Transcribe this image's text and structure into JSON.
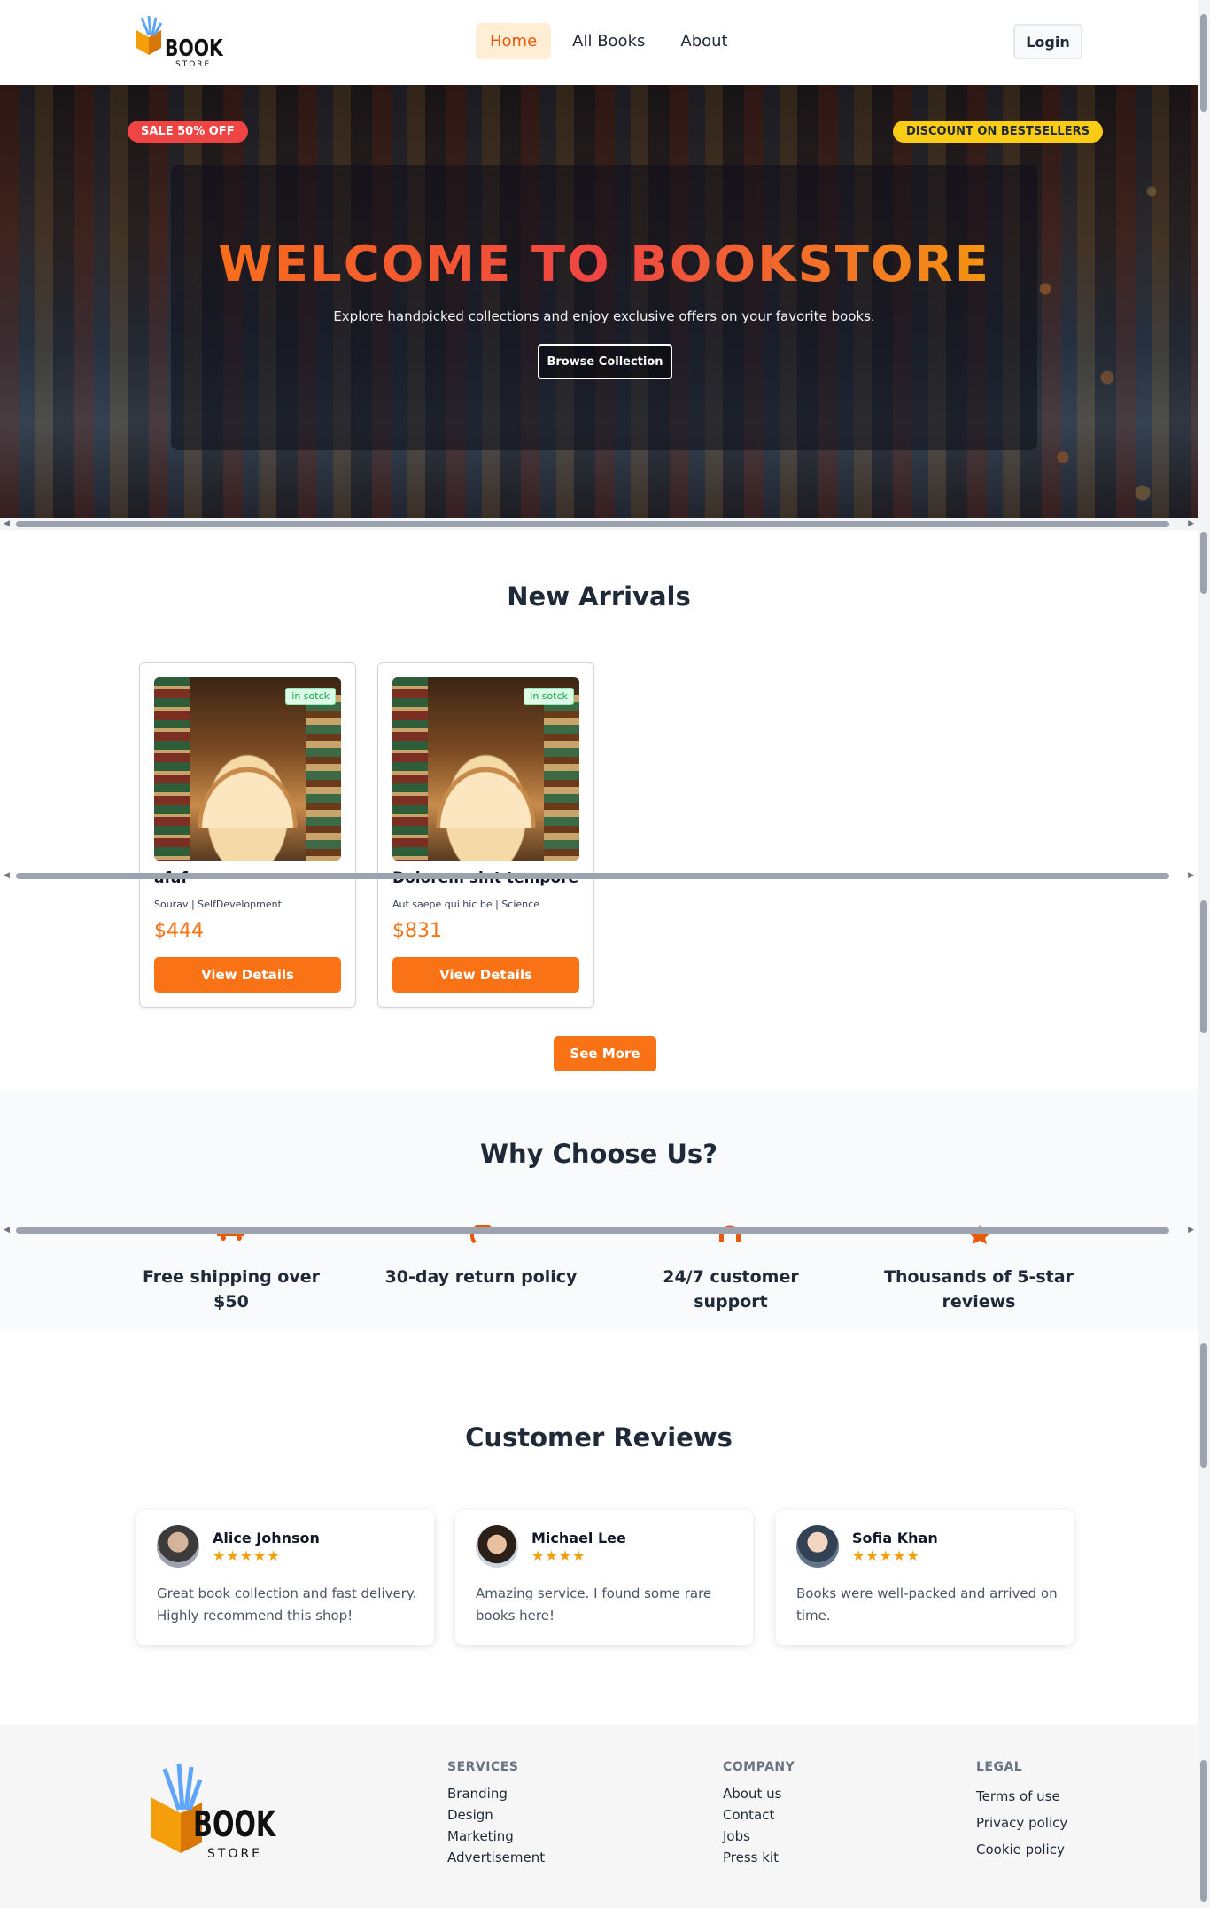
{
  "brand": {
    "logo_main": "BOOK",
    "logo_sub": "STORE"
  },
  "nav": {
    "items": [
      "Home",
      "All Books",
      "About"
    ],
    "active": "Home",
    "login_label": "Login"
  },
  "hero": {
    "badge_left": "SALE 50% OFF",
    "badge_right": "DISCOUNT ON BESTSELLERS",
    "title": "WELCOME TO BOOKSTORE",
    "subtitle": "Explore handpicked collections and enjoy exclusive offers on your favorite books.",
    "cta_label": "Browse Collection"
  },
  "new_arrivals": {
    "title": "New Arrivals",
    "books": [
      {
        "title": "afaf",
        "meta": "Sourav | SelfDevelopment",
        "price": "$444",
        "stock": "in sotck",
        "button": "View Details"
      },
      {
        "title": "Dolorem sint tempore",
        "meta": "Aut saepe qui hic be | Science",
        "price": "$831",
        "stock": "in sotck",
        "button": "View Details"
      }
    ],
    "see_more_label": "See More"
  },
  "why_choose_us": {
    "title": "Why Choose Us?",
    "features": [
      {
        "icon": "truck-icon",
        "label": "Free shipping over $50"
      },
      {
        "icon": "return-icon",
        "label": "30-day return policy"
      },
      {
        "icon": "headset-icon",
        "label": "24/7 customer support"
      },
      {
        "icon": "star-icon",
        "label": "Thousands of 5-star reviews"
      }
    ]
  },
  "reviews": {
    "title": "Customer Reviews",
    "items": [
      {
        "name": "Alice Johnson",
        "stars": "★★★★★",
        "text": "Great book collection and fast delivery. Highly recommend this shop!"
      },
      {
        "name": "Michael Lee",
        "stars": "★★★★",
        "text": "Amazing service. I found some rare books here!"
      },
      {
        "name": "Sofia Khan",
        "stars": "★★★★★",
        "text": "Books were well-packed and arrived on time."
      }
    ]
  },
  "footer": {
    "services": {
      "heading": "SERVICES",
      "links": [
        "Branding",
        "Design",
        "Marketing",
        "Advertisement"
      ]
    },
    "company": {
      "heading": "COMPANY",
      "links": [
        "About us",
        "Contact",
        "Jobs",
        "Press kit"
      ]
    },
    "legal": {
      "heading": "LEGAL",
      "links": [
        "Terms of use",
        "Privacy policy",
        "Cookie policy"
      ]
    }
  },
  "colors": {
    "accent": "#f97316",
    "sale_badge": "#ef4444",
    "discount_badge": "#facc15",
    "star": "#f59e0b",
    "in_stock": "#16a34a"
  }
}
